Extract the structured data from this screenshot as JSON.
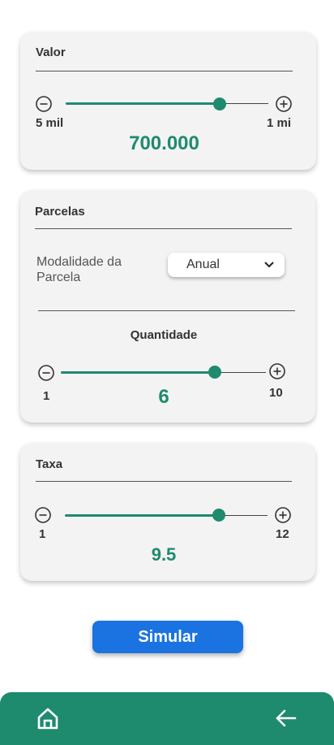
{
  "valor": {
    "title": "Valor",
    "min_label": "5 mil",
    "max_label": "1 mi",
    "value": "700.000",
    "level": 0.73
  },
  "parcelas": {
    "title": "Parcelas",
    "modalidade_label": "Modalidade da Parcela",
    "modalidade_value": "Anual",
    "quantidade_label": "Quantidade",
    "min_label": "1",
    "max_label": "10",
    "value": "6",
    "level": 0.72
  },
  "taxa": {
    "title": "Taxa",
    "min_label": "1",
    "max_label": "12",
    "value": "9.5",
    "level": 0.75
  },
  "action": {
    "simulate_label": "Simular"
  },
  "nav": {
    "home_icon": "home-icon",
    "back_icon": "arrow-left-icon"
  },
  "colors": {
    "accent": "#1e8a6e",
    "button": "#1a73e0",
    "card": "#f3f3f3"
  }
}
